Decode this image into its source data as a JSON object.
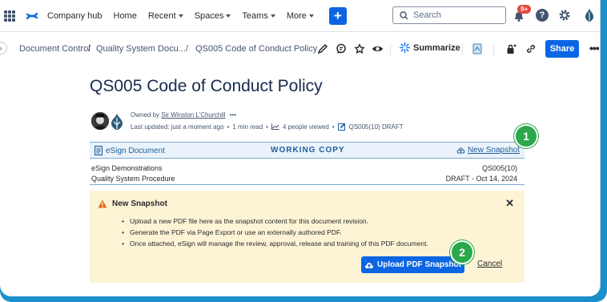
{
  "nav": {
    "items": [
      {
        "label": "Company hub",
        "caret": false
      },
      {
        "label": "Home",
        "caret": false
      },
      {
        "label": "Recent",
        "caret": true
      },
      {
        "label": "Spaces",
        "caret": true
      },
      {
        "label": "Teams",
        "caret": true
      },
      {
        "label": "More",
        "caret": true
      }
    ],
    "create_label": "+",
    "search_placeholder": "Search",
    "notifications_badge": "9+",
    "help_label": "?"
  },
  "breadcrumb": {
    "items": [
      "Document Control",
      "/",
      "Quality System Docu...",
      "/",
      "QS005 Code of Conduct Policy"
    ],
    "summarize_label": "Summarize",
    "share_label": "Share",
    "more_label": "•••"
  },
  "page": {
    "title": "QS005 Code of Conduct Policy",
    "owned_prefix": "Owned by",
    "owner": "Sir Winston L'Churchill",
    "owner_more": "•••",
    "last_updated": "Last updated: just a moment ago",
    "read_time": "1 min read",
    "viewers": "4 people viewed",
    "version_tag": "QS005(10) DRAFT",
    "dot": "•"
  },
  "esign": {
    "left_label": "eSign Document",
    "center_label": "WORKING COPY",
    "right_label": "New Snapshot",
    "rows": [
      {
        "left": "eSign Demonstrations",
        "right": "QS005(10)"
      },
      {
        "left": "Quality System Procedure",
        "right": "DRAFT - Oct 14, 2024"
      }
    ]
  },
  "snapshot_panel": {
    "title": "New Snapshot",
    "close_label": "✕",
    "bullets": [
      "Upload a new PDF file here as the snapshot content for this document revision.",
      "Generate the PDF via Page Export or use an externally authored PDF.",
      "Once attached, eSign will manage the review, approval, release and training of this PDF document."
    ],
    "upload_label": "Upload PDF Snapshot",
    "cancel_label": "Cancel"
  },
  "steps": [
    "1",
    "2"
  ],
  "colors": {
    "primary": "#0c66e4",
    "step_green": "#2aa84a",
    "panel_bg": "#fdf4d6",
    "esign_blue": "#1f5d98",
    "frame_accent": "#1a8fc9"
  }
}
